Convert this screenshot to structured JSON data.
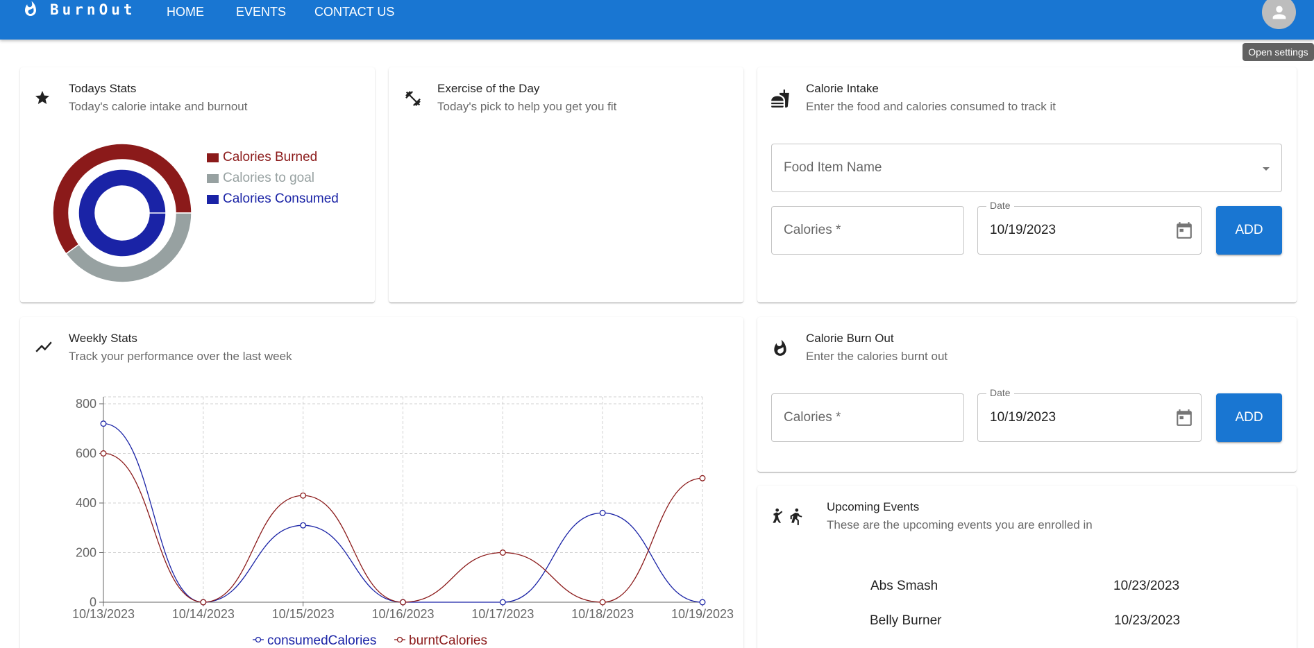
{
  "appbar": {
    "brand": "BurnOut",
    "nav": [
      "HOME",
      "EVENTS",
      "CONTACT US"
    ],
    "tooltip": "Open settings"
  },
  "colors": {
    "primary": "#1976d2",
    "burned": "#8b1a1a",
    "goal": "#97a1a1",
    "consumed": "#1a23a6"
  },
  "todays_stats": {
    "title": "Todays Stats",
    "subtitle": "Today's calorie intake and burnout",
    "icon": "star-icon",
    "legend": [
      "Calories Burned",
      "Calories to goal",
      "Calories Consumed"
    ],
    "outer_burned_fraction": 0.6,
    "outer_goal_fraction": 0.4,
    "inner_consumed_fraction": 1.0
  },
  "exercise": {
    "title": "Exercise of the Day",
    "subtitle": "Today's pick to help you get you fit",
    "icon": "dumbbell-icon"
  },
  "calorie_intake": {
    "title": "Calorie Intake",
    "subtitle": "Enter the food and calories consumed to track it",
    "icon": "fastfood-icon",
    "food_placeholder": "Food Item Name",
    "calories_placeholder": "Calories *",
    "date_label": "Date",
    "date_value": "10/19/2023",
    "button": "ADD"
  },
  "weekly_stats": {
    "title": "Weekly Stats",
    "subtitle": "Track your performance over the last week",
    "icon": "trending-icon"
  },
  "calorie_burnout": {
    "title": "Calorie Burn Out",
    "subtitle": "Enter the calories burnt out",
    "icon": "flame-icon",
    "calories_placeholder": "Calories *",
    "date_label": "Date",
    "date_value": "10/19/2023",
    "button": "ADD"
  },
  "upcoming_events": {
    "title": "Upcoming Events",
    "subtitle": "These are the upcoming events you are enrolled in",
    "icon": "sports-icon",
    "events": [
      {
        "name": "Abs Smash",
        "date": "10/23/2023"
      },
      {
        "name": "Belly Burner",
        "date": "10/23/2023"
      }
    ]
  },
  "chart_data": {
    "type": "line",
    "categories": [
      "10/13/2023",
      "10/14/2023",
      "10/15/2023",
      "10/16/2023",
      "10/17/2023",
      "10/18/2023",
      "10/19/2023"
    ],
    "series": [
      {
        "name": "consumedCalories",
        "color": "#1a23a6",
        "values": [
          720,
          0,
          310,
          0,
          0,
          360,
          0
        ]
      },
      {
        "name": "burntCalories",
        "color": "#8b1a1a",
        "values": [
          600,
          0,
          430,
          0,
          200,
          0,
          500
        ]
      }
    ],
    "yticks": [
      0,
      200,
      400,
      600,
      800
    ],
    "ylim": [
      0,
      800
    ],
    "grid": true,
    "legend": "bottom"
  }
}
